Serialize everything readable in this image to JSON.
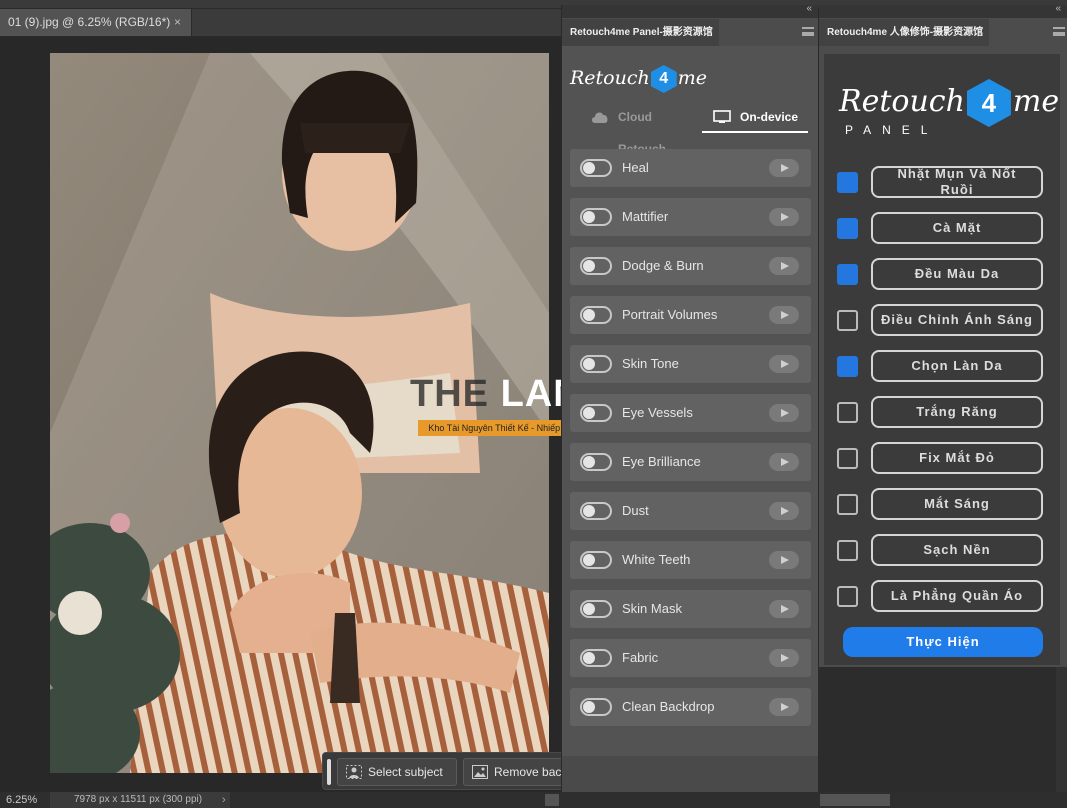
{
  "document": {
    "tab_title": "01 (9).jpg @ 6.25% (RGB/16*)",
    "close_glyph": "×",
    "zoom": "6.25%",
    "doc_info": "7978 px x 11511 px (300 ppi)",
    "chevron": "›"
  },
  "context_bar": {
    "select_subject": "Select subject",
    "remove_background": "Remove background",
    "more": "•••"
  },
  "panel_retouch": {
    "collapse_glyph": "«",
    "tab_title": "Retouch4me Panel-摄影资源馆",
    "logo_left": "Retouch",
    "logo_right": "me",
    "mode_tabs": {
      "cloud": "Cloud Retouch",
      "device": "On-device"
    },
    "functions": [
      "Heal",
      "Mattifier",
      "Dodge & Burn",
      "Portrait Volumes",
      "Skin Tone",
      "Eye Vessels",
      "Eye Brilliance",
      "Dust",
      "White Teeth",
      "Skin Mask",
      "Fabric",
      "Clean Backdrop"
    ]
  },
  "panel_vn": {
    "collapse_glyph": "«",
    "tab_title": "Retouch4me 人像修饰-摄影资源馆",
    "logo_left": "Retouch",
    "logo_right": "me",
    "logo_sub": "PANEL",
    "options": [
      {
        "label": "Nhặt Mụn Và Nốt Ruồi",
        "checked": true
      },
      {
        "label": "Cà Mặt",
        "checked": true
      },
      {
        "label": "Đều Màu Da",
        "checked": true
      },
      {
        "label": "Điều Chỉnh Ánh Sáng",
        "checked": false
      },
      {
        "label": "Chọn Làn Da",
        "checked": true
      },
      {
        "label": "Trắng Răng",
        "checked": false
      },
      {
        "label": "Fix Mắt Đỏ",
        "checked": false
      },
      {
        "label": "Mắt Sáng",
        "checked": false
      },
      {
        "label": "Sạch Nền",
        "checked": false
      },
      {
        "label": "Là Phẳng Quần Áo",
        "checked": false
      }
    ],
    "run_button": "Thực Hiện"
  },
  "watermark": {
    "the": "THE",
    "lanb": "LANB",
    "subtitle": "Kho Tài Nguyên Thiết Kế - Nhiếp Ảnh - Làm Film"
  },
  "colors": {
    "accent_blue": "#1f7ce8",
    "checkbox_on": "#2577e0",
    "watermark_orange": "#e79a2a"
  },
  "icons": [
    "cloud-icon",
    "monitor-icon",
    "person-select-icon",
    "image-remove-bg-icon",
    "transform-icon",
    "mask-circle-icon",
    "more-icon",
    "menu-icon",
    "collapse-icon"
  ]
}
